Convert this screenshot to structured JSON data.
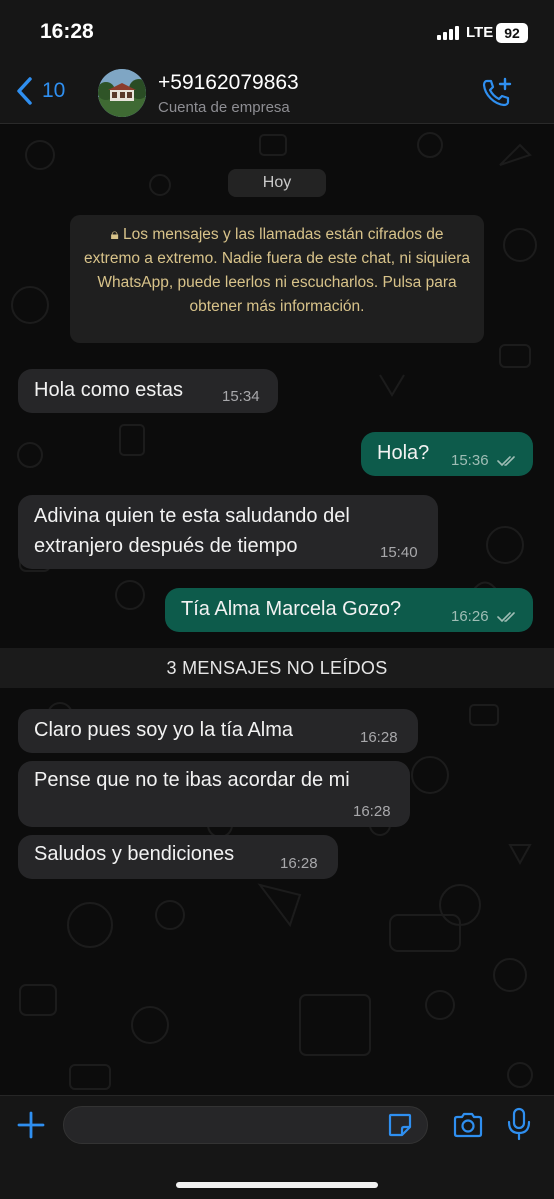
{
  "status_bar": {
    "time": "16:28",
    "network": "LTE",
    "battery": "92"
  },
  "header": {
    "back_count": "10",
    "contact_name": "+59162079863",
    "contact_subtitle": "Cuenta de empresa"
  },
  "chat": {
    "day_label": "Hoy",
    "encryption_notice": "Los mensajes y las llamadas están cifrados de extremo a extremo. Nadie fuera de este chat, ni siquiera WhatsApp, puede leerlos ni escucharlos. Pulsa para obtener más información.",
    "unread_label": "3 MENSAJES NO LEÍDOS",
    "messages": [
      {
        "direction": "incoming",
        "lines": [
          "Hola como estas"
        ],
        "time": "15:34"
      },
      {
        "direction": "outgoing",
        "lines": [
          "Hola?"
        ],
        "time": "15:36",
        "status": "read"
      },
      {
        "direction": "incoming",
        "lines": [
          "Adivina quien te esta saludando del",
          "extranjero después de tiempo"
        ],
        "time": "15:40"
      },
      {
        "direction": "outgoing",
        "lines": [
          "Tía Alma Marcela Gozo?"
        ],
        "time": "16:26",
        "status": "read"
      },
      {
        "direction": "incoming",
        "lines": [
          "Claro pues soy yo la tía Alma"
        ],
        "time": "16:28"
      },
      {
        "direction": "incoming",
        "lines": [
          "Pense que no te ibas acordar de mi"
        ],
        "time": "16:28"
      },
      {
        "direction": "incoming",
        "lines": [
          "Saludos y bendiciones"
        ],
        "time": "16:28"
      }
    ]
  },
  "input_bar": {
    "placeholder": ""
  },
  "colors": {
    "accent": "#2f8ff0",
    "outgoing_bubble": "#0d5b4b",
    "incoming_bubble": "#262628",
    "notice_text": "#d8c38a"
  },
  "icons": [
    "chevron-left-icon",
    "add-call-icon",
    "lock-icon",
    "double-check-icon",
    "plus-icon",
    "sticker-icon",
    "camera-icon",
    "microphone-icon"
  ]
}
